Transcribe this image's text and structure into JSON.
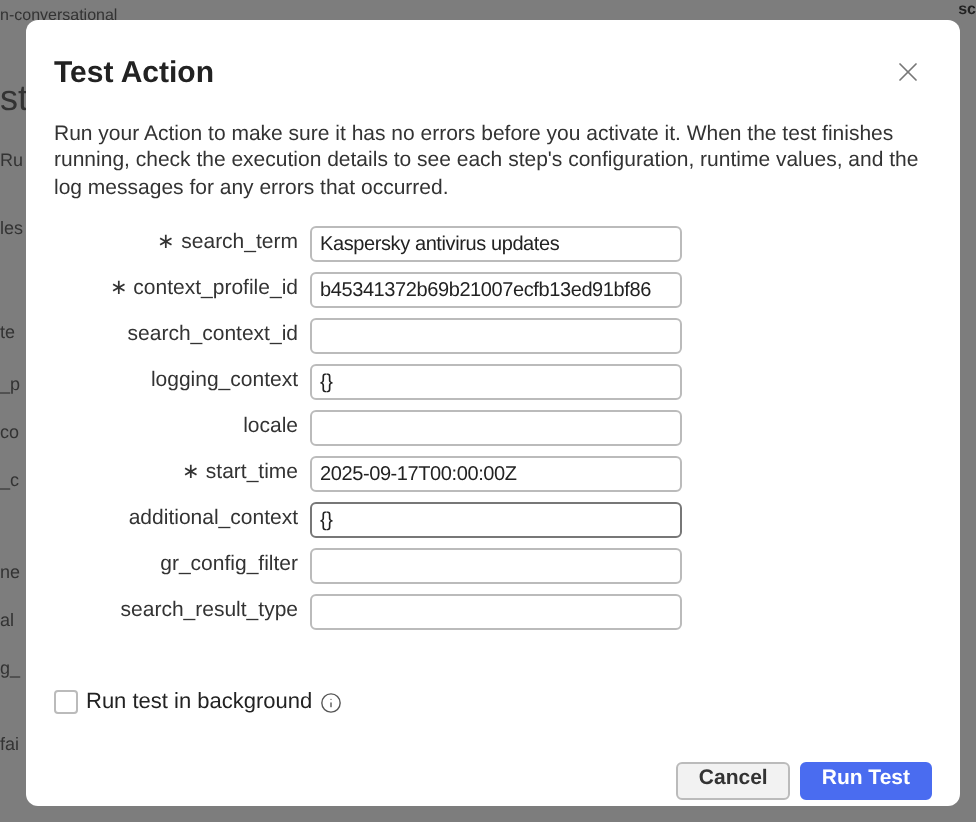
{
  "background": {
    "top_fragment": "n-conversational",
    "top_right_fragment": "sc",
    "left_fragments": [
      "st",
      "Ru",
      "les",
      "te",
      "_p",
      "co",
      "_c",
      "ne",
      "al",
      "g_",
      "fai"
    ]
  },
  "dialog": {
    "title": "Test Action",
    "description": "Run your Action to make sure it has no errors before you activate it. When the test finishes running, check the execution details to see each step's configuration, runtime values, and the log messages for any errors that occurred.",
    "fields": [
      {
        "label": "∗ search_term",
        "value": "Kaspersky antivirus updates",
        "focused": false
      },
      {
        "label": "∗ context_profile_id",
        "value": "b45341372b69b21007ecfb13ed91bf86",
        "focused": false
      },
      {
        "label": "search_context_id",
        "focused": false
      },
      {
        "label": "logging_context",
        "value": "{}",
        "focused": false
      },
      {
        "label": "locale",
        "focused": false
      },
      {
        "label": "∗ start_time",
        "value": "2025-09-17T00:00:00Z",
        "focused": false
      },
      {
        "label": "additional_context",
        "value": "{}",
        "focused": true
      },
      {
        "label": "gr_config_filter",
        "focused": false
      },
      {
        "label": "search_result_type",
        "focused": false
      }
    ],
    "background_option": {
      "label": "Run test in background",
      "checked": false
    },
    "buttons": [
      {
        "label": "Cancel",
        "kind": "secondary"
      },
      {
        "label": "Run Test",
        "kind": "primary"
      }
    ]
  }
}
